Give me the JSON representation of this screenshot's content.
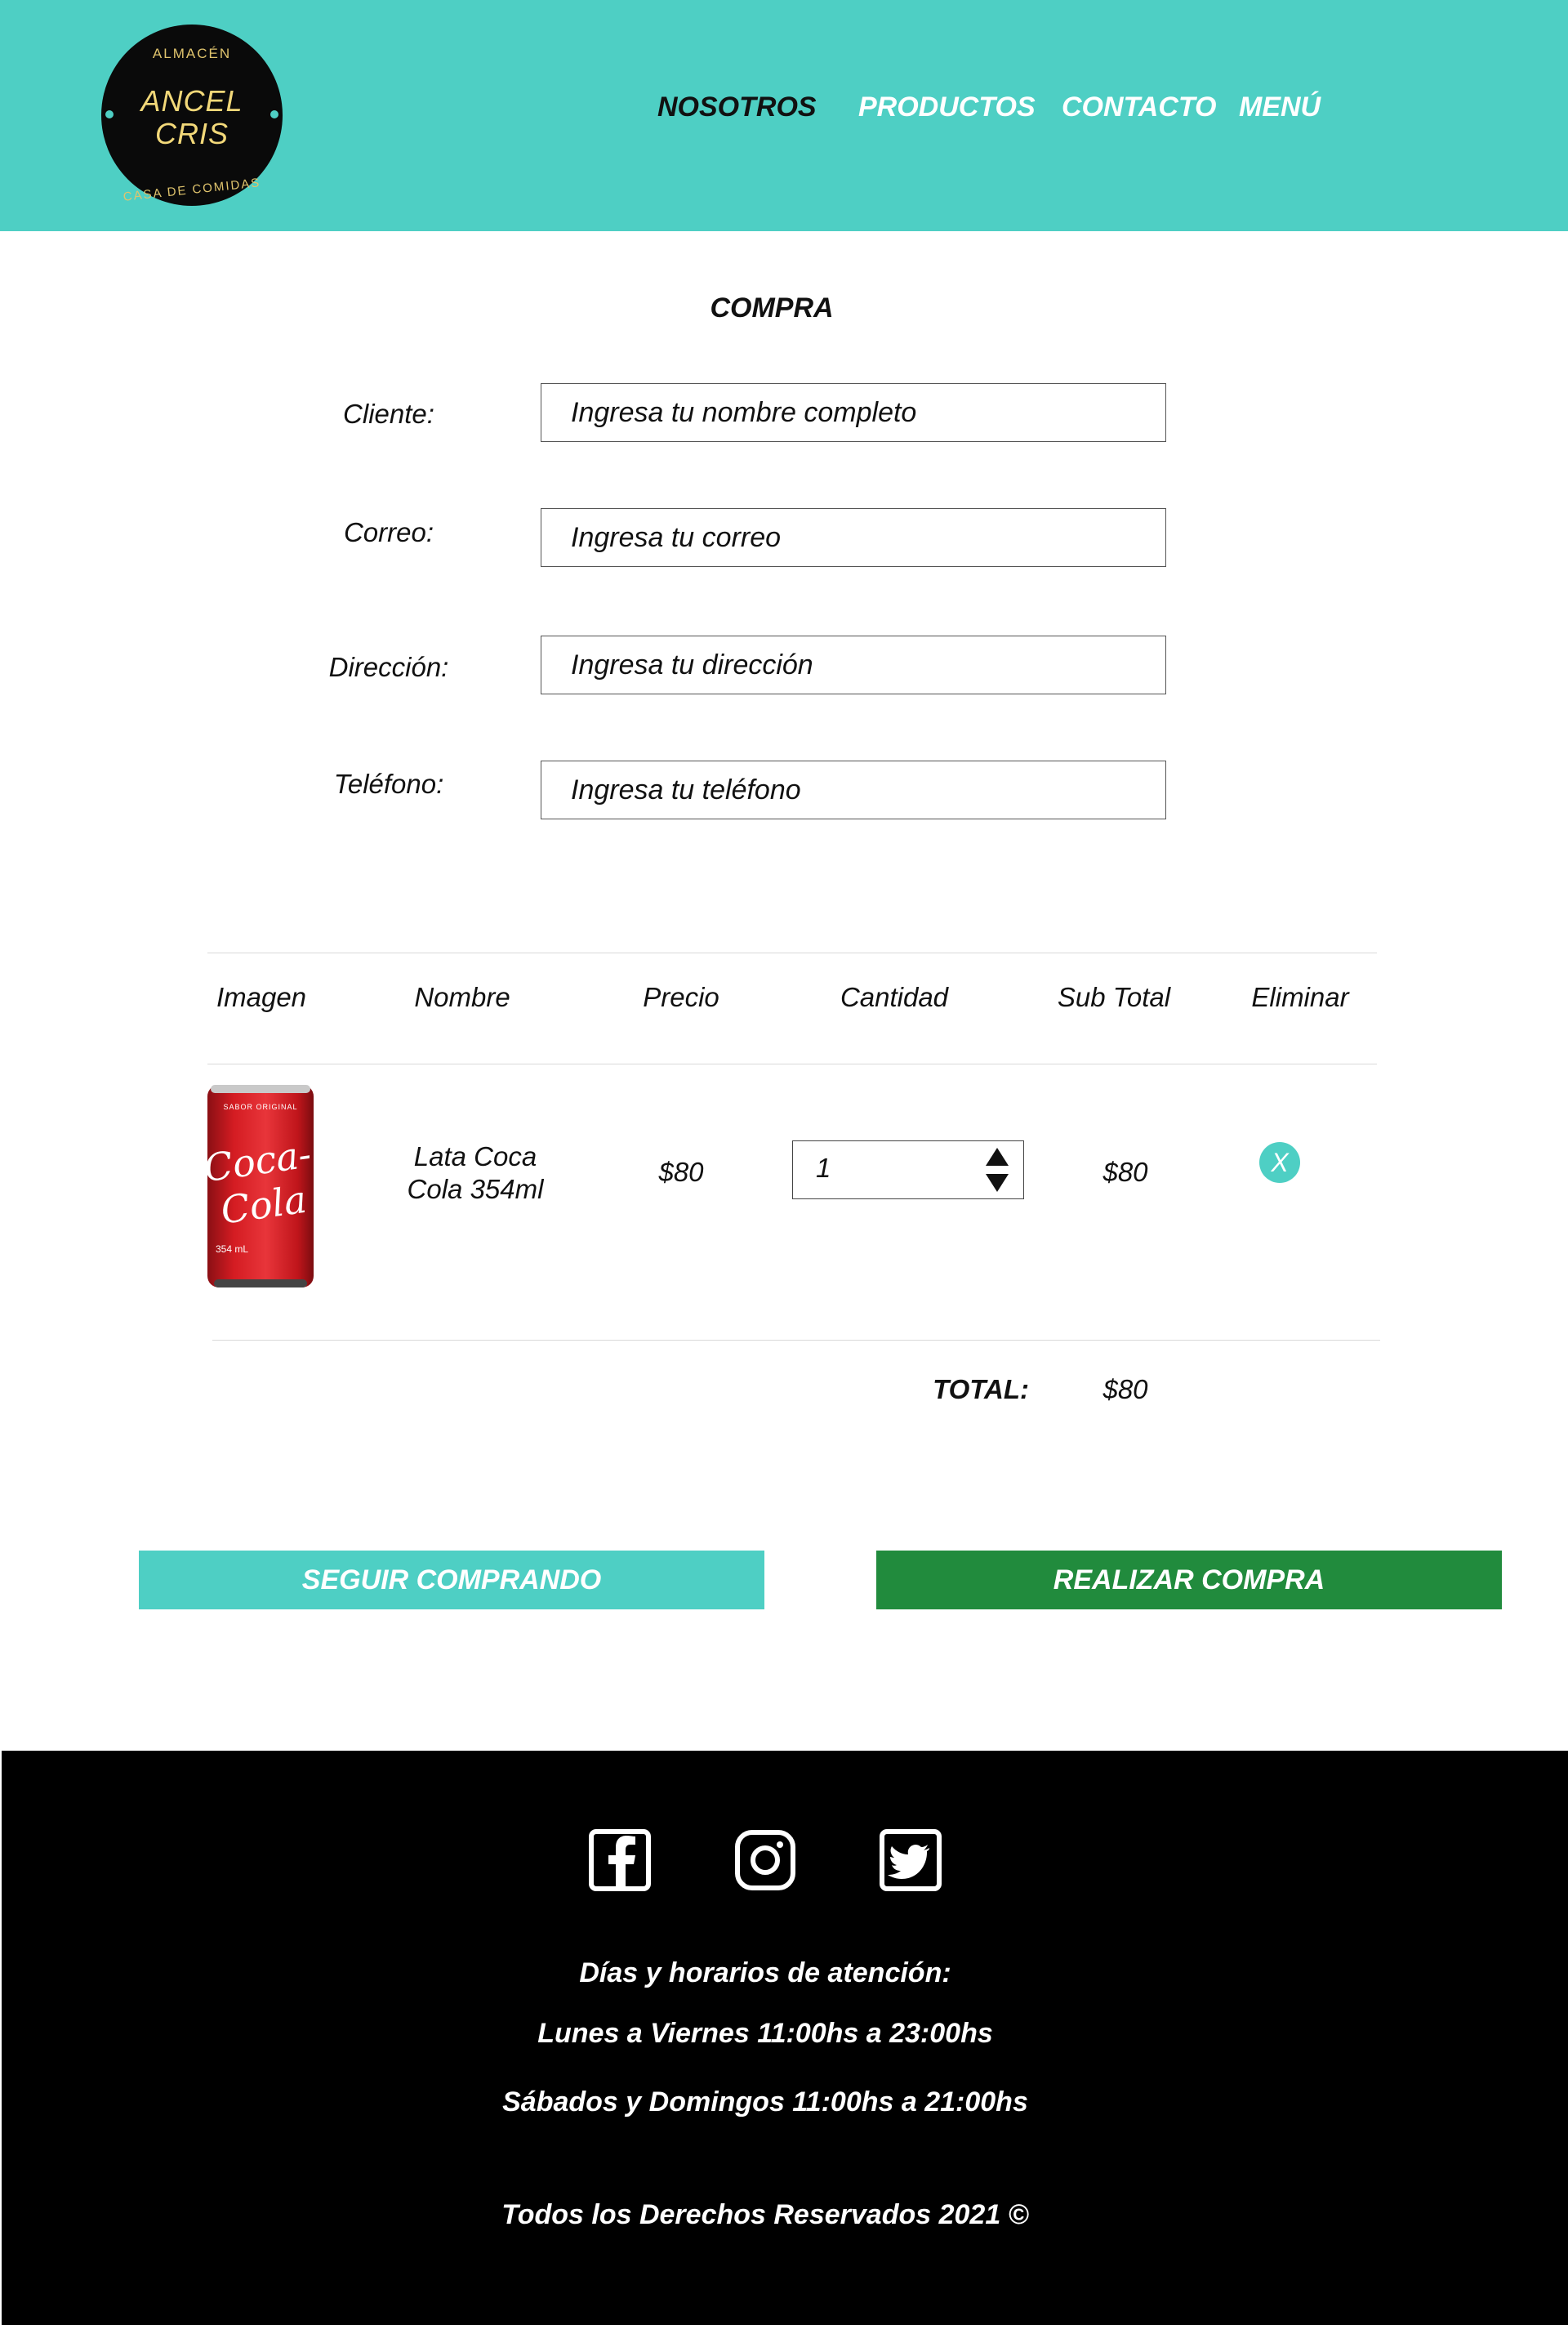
{
  "header": {
    "logo": {
      "top_text": "ALMACÉN",
      "name_line1": "ANCEL",
      "name_line2": "CRIS",
      "bottom_text": "CASA DE COMIDAS"
    },
    "nav": [
      {
        "label": "NOSOTROS",
        "active": true
      },
      {
        "label": "PRODUCTOS"
      },
      {
        "label": "CONTACTO"
      },
      {
        "label": "MENÚ"
      }
    ]
  },
  "form": {
    "title": "COMPRA",
    "fields": [
      {
        "label": "Cliente:",
        "placeholder": "Ingresa tu nombre completo"
      },
      {
        "label": "Correo:",
        "placeholder": "Ingresa tu correo"
      },
      {
        "label": "Dirección:",
        "placeholder": "Ingresa tu dirección"
      },
      {
        "label": "Teléfono:",
        "placeholder": "Ingresa tu teléfono"
      }
    ]
  },
  "cart": {
    "columns": [
      "Imagen",
      "Nombre",
      "Precio",
      "Cantidad",
      "Sub Total",
      "Eliminar"
    ],
    "rows": [
      {
        "image": {
          "brand": "Coca-Cola",
          "tagline": "SABOR ORIGINAL",
          "volume": "354 mL"
        },
        "name_line1": "Lata Coca",
        "name_line2": "Cola 354ml",
        "price": "$80",
        "quantity": "1",
        "subtotal": "$80",
        "delete_label": "X"
      }
    ],
    "total_label": "TOTAL:",
    "total_value": "$80"
  },
  "actions": {
    "continue_label": "SEGUIR COMPRANDO",
    "checkout_label": "REALIZAR COMPRA"
  },
  "footer": {
    "social": [
      "facebook-icon",
      "instagram-icon",
      "twitter-icon"
    ],
    "hours_title": "Días y horarios de atención:",
    "hours_weekdays": "Lunes a Viernes 11:00hs a 23:00hs",
    "hours_weekend": "Sábados y Domingos 11:00hs a 21:00hs",
    "copyright": "Todos los Derechos Reservados 2021 ©"
  },
  "colors": {
    "accent": "#4ecfc4",
    "checkout": "#218b3d",
    "footer_bg": "#000000",
    "logo_gold": "#f2d879"
  }
}
